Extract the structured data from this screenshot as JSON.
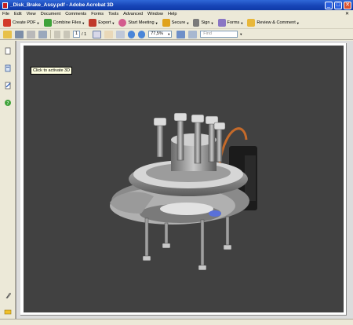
{
  "window": {
    "title": "_Disk_Brake_Assy.pdf - Adobe Acrobat 3D",
    "minimize": "_",
    "maximize": "□",
    "close": "✕"
  },
  "menu": [
    "File",
    "Edit",
    "View",
    "Document",
    "Comments",
    "Forms",
    "Tools",
    "Advanced",
    "Window",
    "Help"
  ],
  "menu_close": "✕",
  "toolbar": {
    "create_pdf": "Create PDF",
    "combine_files": "Combine Files",
    "export": "Export",
    "start_meeting": "Start Meeting",
    "secure": "Secure",
    "sign": "Sign",
    "forms": "Forms",
    "review_comment": "Review & Comment"
  },
  "nav": {
    "page_current": "1",
    "page_total": "/ 1",
    "zoom": "77,5%",
    "find_placeholder": "Find"
  },
  "document": {
    "tooltip": "Click to activate 3D"
  },
  "colors": {
    "titlebar": "#1846b8",
    "chrome": "#ece9d8",
    "viewport_bg": "#414141",
    "tooltip_bg": "#ffffe1"
  }
}
